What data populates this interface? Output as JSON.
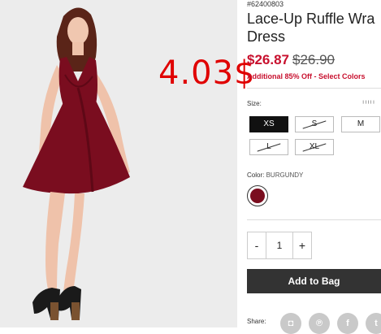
{
  "overlay": {
    "price_text": "4.03$"
  },
  "product": {
    "sku": "#62400803",
    "title_line1": "Lace-Up Ruffle Wra",
    "title_line2": "Dress",
    "sale_price": "$26.87",
    "original_price": "$26.90",
    "promo": "Additional 85% Off - Select Colors"
  },
  "sizes": {
    "label": "Size:",
    "guide_icon": "ruler-icon",
    "options": [
      {
        "label": "XS",
        "state": "selected"
      },
      {
        "label": "S",
        "state": "unavailable"
      },
      {
        "label": "M",
        "state": "available"
      },
      {
        "label": "L",
        "state": "unavailable"
      },
      {
        "label": "XL",
        "state": "unavailable"
      }
    ]
  },
  "color": {
    "label": "Color:",
    "value": "BURGUNDY",
    "swatch": "#7a0d1f"
  },
  "quantity": {
    "minus": "-",
    "value": "1",
    "plus": "+"
  },
  "cart": {
    "add_label": "Add to Bag"
  },
  "share": {
    "label": "Share:",
    "icons": [
      "instagram-icon",
      "pinterest-icon",
      "facebook-icon",
      "twitter-icon"
    ]
  },
  "colors": {
    "accent_red": "#c8102e",
    "overlay_red": "#e00000",
    "button_dark": "#333333"
  }
}
